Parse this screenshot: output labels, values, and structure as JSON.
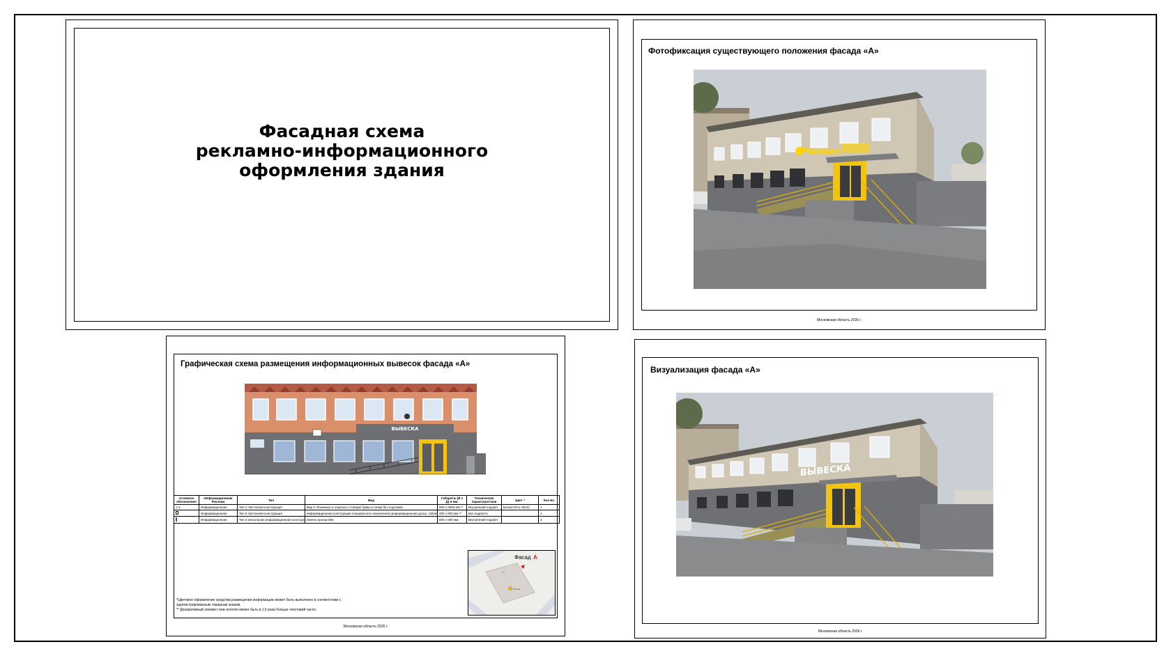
{
  "title_sheet": {
    "line1": "Фасадная схема",
    "line2": "рекламно-информационного",
    "line3": "оформления здания"
  },
  "photo_sheet": {
    "heading": "Фотофиксация существующего положения фасада «А»",
    "sign_text": "Чижик",
    "footer": "Московская область 2026 г."
  },
  "scheme_sheet": {
    "heading": "Графическая схема размещения информационных вывесок фасада «А»",
    "sign_text": "ВЫВЕСКА",
    "table": {
      "headers": [
        "Условное обозначение",
        "Информационная/ Реклама",
        "Тип",
        "Вид",
        "Габариты (В х Д) в мм.",
        "Технические Характеристики",
        "Цвет *",
        "Кол-во"
      ],
      "rows": [
        [
          "А-1",
          "Информационная",
          "Тип 2 Настенная конструкция",
          "Вид 2 объемные и отдельно стоящие буквы и знаки без подложки",
          "500 x 6560 мм.**",
          "Внутренний подсвет",
          "Белый (RAL 9010)",
          "1"
        ],
        [
          "",
          "Информационная",
          "Тип 5 Настенная конструкция",
          "информационная конструкция специального назначения (информационная доска, табличка)",
          "400 x 600 мм.**",
          "Без подсвета",
          "",
          "1"
        ],
        [
          "",
          "Информационная",
          "Тип 3 консольная информационная конструкция",
          "панель-кронштейн",
          "500 x 500 мм.",
          "Внутренний подсвет",
          "",
          "2"
        ]
      ]
    },
    "notes": [
      "*Цветовое оформление средства размещения информацию может быть выполнено в соответствии с зарегистрированным товарным знаком.",
      "** Декоративный элемент или логотип может быть в 1,5 раза больше текстовой части."
    ],
    "map_label_prefix": "Фасад",
    "map_label_letter": "А",
    "map_house": "44",
    "map_shop": "Чижик",
    "footer": "Московская область 2026 г."
  },
  "visual_sheet": {
    "heading": "Визуализация фасада «А»",
    "sign_text": "ВЫВЕСКА",
    "footer": "Московская область 2026 г."
  },
  "colors": {
    "brick_orange": "#d9906a",
    "facade_grey": "#6e6f73",
    "door_yellow": "#f2c40f",
    "sign_yellow": "#ffd400",
    "sky": "#c9cfd4",
    "asphalt": "#8a8b8c"
  }
}
